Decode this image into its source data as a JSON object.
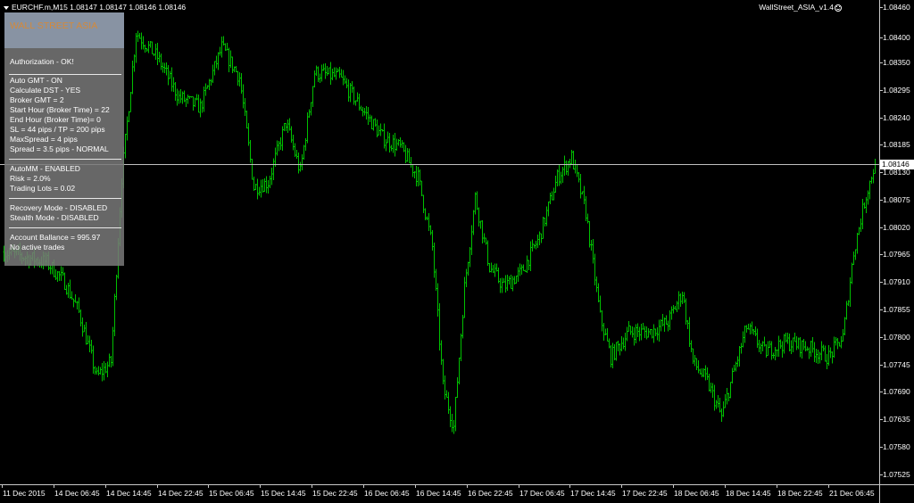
{
  "symbol_bar": {
    "text": "EURCHF.m,M15  1.08147 1.08147 1.08146 1.08146"
  },
  "ea": {
    "name": "WallStreet_ASIA_v1.4",
    "status_icon": "smiley-icon"
  },
  "panel": {
    "title": "WALL STREET ASIA",
    "lines": [
      "Authorization - OK!",
      "Auto GMT - ON",
      "Calculate DST - YES",
      "Broker GMT = 2",
      "Start Hour (Broker Time) = 22",
      "End Hour (Broker Time)= 0",
      "SL = 44 pips / TP = 200 pips",
      "MaxSpread = 4 pips",
      "Spread = 3.5 pips - NORMAL",
      "AutoMM - ENABLED",
      "Risk = 2.0%",
      "Trading Lots = 0.02",
      "Recovery Mode - DISABLED",
      "Stealth Mode - DISABLED",
      "Account Ballance = 995.97",
      "No active trades"
    ],
    "colors": {
      "background": "#7a7a7a",
      "header": "#8a96a6",
      "title": "#d4893a"
    }
  },
  "price_axis": {
    "labels": [
      "1.08460",
      "1.08400",
      "1.08350",
      "1.08295",
      "1.08240",
      "1.08185",
      "1.08130",
      "1.08075",
      "1.08020",
      "1.07965",
      "1.07910",
      "1.07855",
      "1.07800",
      "1.07745",
      "1.07690",
      "1.07635",
      "1.07580",
      "1.07525"
    ],
    "bid": "1.08146"
  },
  "time_axis": {
    "labels": [
      "11 Dec 2015",
      "14 Dec 06:45",
      "14 Dec 14:45",
      "14 Dec 22:45",
      "15 Dec 06:45",
      "15 Dec 14:45",
      "15 Dec 22:45",
      "16 Dec 06:45",
      "16 Dec 14:45",
      "16 Dec 22:45",
      "17 Dec 06:45",
      "17 Dec 14:45",
      "17 Dec 22:45",
      "18 Dec 06:45",
      "18 Dec 14:45",
      "18 Dec 22:45",
      "21 Dec 06:45"
    ]
  },
  "chart_data": {
    "type": "bar",
    "symbol": "EURCHF.m",
    "timeframe": "M15",
    "ylim": [
      1.07505,
      1.08475
    ],
    "bid": 1.08146,
    "bar_color": "#00c000",
    "close_series": [
      {
        "bar": 0,
        "close": 1.0797
      },
      {
        "bar": 12,
        "close": 1.0796
      },
      {
        "bar": 24,
        "close": 1.0795
      },
      {
        "bar": 34,
        "close": 1.0791
      },
      {
        "bar": 42,
        "close": 1.0785
      },
      {
        "bar": 52,
        "close": 1.0772
      },
      {
        "bar": 60,
        "close": 1.0775
      },
      {
        "bar": 66,
        "close": 1.0812
      },
      {
        "bar": 74,
        "close": 1.0841
      },
      {
        "bar": 86,
        "close": 1.0836
      },
      {
        "bar": 98,
        "close": 1.0828
      },
      {
        "bar": 110,
        "close": 1.0826
      },
      {
        "bar": 122,
        "close": 1.0838
      },
      {
        "bar": 132,
        "close": 1.0832
      },
      {
        "bar": 140,
        "close": 1.081
      },
      {
        "bar": 148,
        "close": 1.0811
      },
      {
        "bar": 158,
        "close": 1.0823
      },
      {
        "bar": 166,
        "close": 1.0813
      },
      {
        "bar": 174,
        "close": 1.0833
      },
      {
        "bar": 188,
        "close": 1.0832
      },
      {
        "bar": 200,
        "close": 1.0826
      },
      {
        "bar": 212,
        "close": 1.082
      },
      {
        "bar": 222,
        "close": 1.0818
      },
      {
        "bar": 232,
        "close": 1.0812
      },
      {
        "bar": 240,
        "close": 1.0798
      },
      {
        "bar": 246,
        "close": 1.077
      },
      {
        "bar": 252,
        "close": 1.0762
      },
      {
        "bar": 258,
        "close": 1.079
      },
      {
        "bar": 264,
        "close": 1.0808
      },
      {
        "bar": 272,
        "close": 1.0794
      },
      {
        "bar": 280,
        "close": 1.079
      },
      {
        "bar": 290,
        "close": 1.0793
      },
      {
        "bar": 300,
        "close": 1.08
      },
      {
        "bar": 310,
        "close": 1.0812
      },
      {
        "bar": 318,
        "close": 1.0816
      },
      {
        "bar": 326,
        "close": 1.0805
      },
      {
        "bar": 334,
        "close": 1.0784
      },
      {
        "bar": 340,
        "close": 1.0776
      },
      {
        "bar": 350,
        "close": 1.0781
      },
      {
        "bar": 362,
        "close": 1.0781
      },
      {
        "bar": 372,
        "close": 1.0783
      },
      {
        "bar": 380,
        "close": 1.0789
      },
      {
        "bar": 386,
        "close": 1.0775
      },
      {
        "bar": 394,
        "close": 1.0771
      },
      {
        "bar": 402,
        "close": 1.0764
      },
      {
        "bar": 408,
        "close": 1.0772
      },
      {
        "bar": 416,
        "close": 1.0782
      },
      {
        "bar": 426,
        "close": 1.0777
      },
      {
        "bar": 438,
        "close": 1.0779
      },
      {
        "bar": 450,
        "close": 1.0778
      },
      {
        "bar": 462,
        "close": 1.0776
      },
      {
        "bar": 470,
        "close": 1.078
      },
      {
        "bar": 476,
        "close": 1.0797
      },
      {
        "bar": 482,
        "close": 1.0807
      },
      {
        "bar": 488,
        "close": 1.0815
      }
    ]
  }
}
